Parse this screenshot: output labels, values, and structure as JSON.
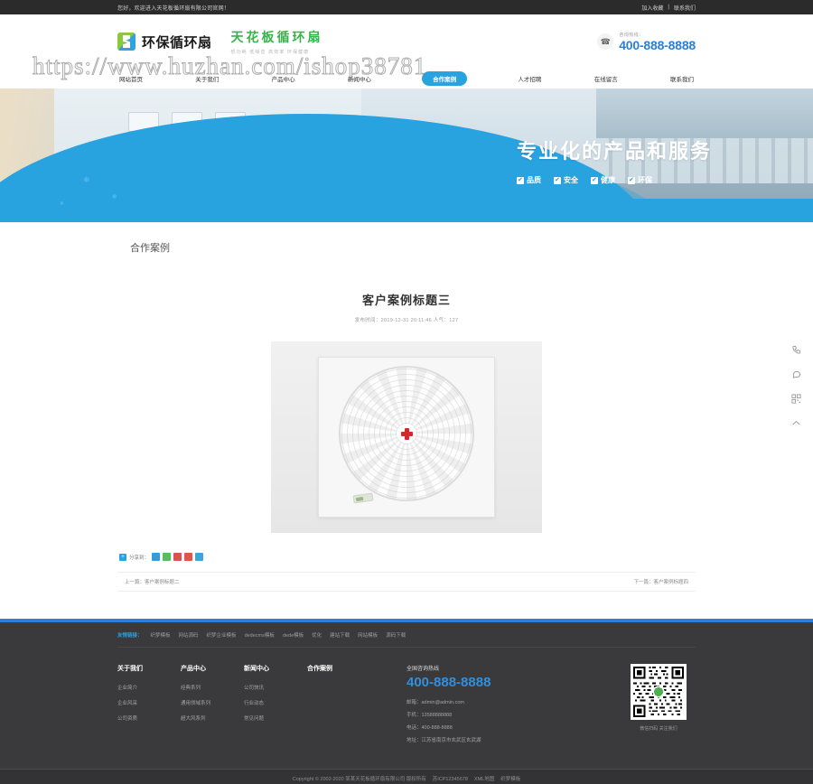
{
  "topbar": {
    "welcome": "您好，欢迎进入天花板循环扇有限公司官网！",
    "favorite": "加入收藏",
    "separator": "|",
    "contact": "联系我们"
  },
  "header": {
    "logo_text": "环保循环扇",
    "slogan_main": "天花板循环扇",
    "slogan_sub": "低功耗  低噪音  高效率  环保健康",
    "hotline_label": "咨询热线：",
    "hotline_number": "400-888-8888",
    "phone_icon": "phone-icon"
  },
  "nav": {
    "items": [
      {
        "label": "网站首页",
        "active": false
      },
      {
        "label": "关于我们",
        "active": false
      },
      {
        "label": "产品中心",
        "active": false
      },
      {
        "label": "新闻中心",
        "active": false
      },
      {
        "label": "合作案例",
        "active": true
      },
      {
        "label": "人才招聘",
        "active": false
      },
      {
        "label": "在线留言",
        "active": false
      },
      {
        "label": "联系我们",
        "active": false
      }
    ]
  },
  "banner": {
    "title": "专业化的产品和服务",
    "tags": [
      "品质",
      "安全",
      "健康",
      "环保"
    ],
    "check_glyph": "✔"
  },
  "main": {
    "section_title": "合作案例",
    "article": {
      "title": "客户案例标题三",
      "meta": "发布时间：2019-12-31 20:11:46 人气：127",
      "image_alt": "天花板循环扇产品图"
    },
    "share": {
      "label": "分享到：",
      "plus": "+",
      "icons": [
        "qq-share-icon",
        "wechat-share-icon",
        "weibo-share-icon",
        "renren-share-icon",
        "qzone-share-icon"
      ],
      "icon_colors": [
        "#3a9ad9",
        "#5bbd5b",
        "#d9534f",
        "#e0534f",
        "#41a4d8"
      ]
    },
    "pager": {
      "prev": "上一篇：客户案例标题二",
      "next": "下一篇：客户案例标题四"
    }
  },
  "footer": {
    "links_lead": "友情链接：",
    "links": [
      "织梦模板",
      "网站源码",
      "织梦企业模板",
      "dedecms模板",
      "dede模板",
      "优化",
      "建站下载",
      "网站模板",
      "源码下载"
    ],
    "columns": [
      {
        "heading": "关于我们",
        "items": [
          "企业简介",
          "企业风采",
          "公司资质"
        ]
      },
      {
        "heading": "产品中心",
        "items": [
          "经典系列",
          "通用领域系列",
          "超大风系列"
        ]
      },
      {
        "heading": "新闻中心",
        "items": [
          "公司快讯",
          "行业动态",
          "常见问题"
        ]
      },
      {
        "heading": "合作案例",
        "items": []
      }
    ],
    "contact": {
      "label": "全国咨询热线",
      "number": "400-888-8888",
      "email": "邮箱：admin@admin.com",
      "mobile": "手机：13588888888",
      "tel": "电话：400-888-8888",
      "address": "地址：江苏省南京市玄武区玄武湖"
    },
    "qr_caption": "微信扫码 关注我们",
    "copyright": "Copyright © 2002-2020 某某天花板循环扇有限公司 版权所有",
    "icp": "苏ICP12345678",
    "xml": "XML地图",
    "template": "织梦模板"
  },
  "floatbar": {
    "items": [
      {
        "name": "phone-icon",
        "glyph": "☎"
      },
      {
        "name": "message-icon",
        "glyph": "○"
      },
      {
        "name": "qrcode-icon",
        "glyph": "▒"
      },
      {
        "name": "back-to-top-icon",
        "glyph": "∧"
      }
    ]
  },
  "watermark": {
    "text": "https://www.huzhan.com/ishop38781"
  }
}
